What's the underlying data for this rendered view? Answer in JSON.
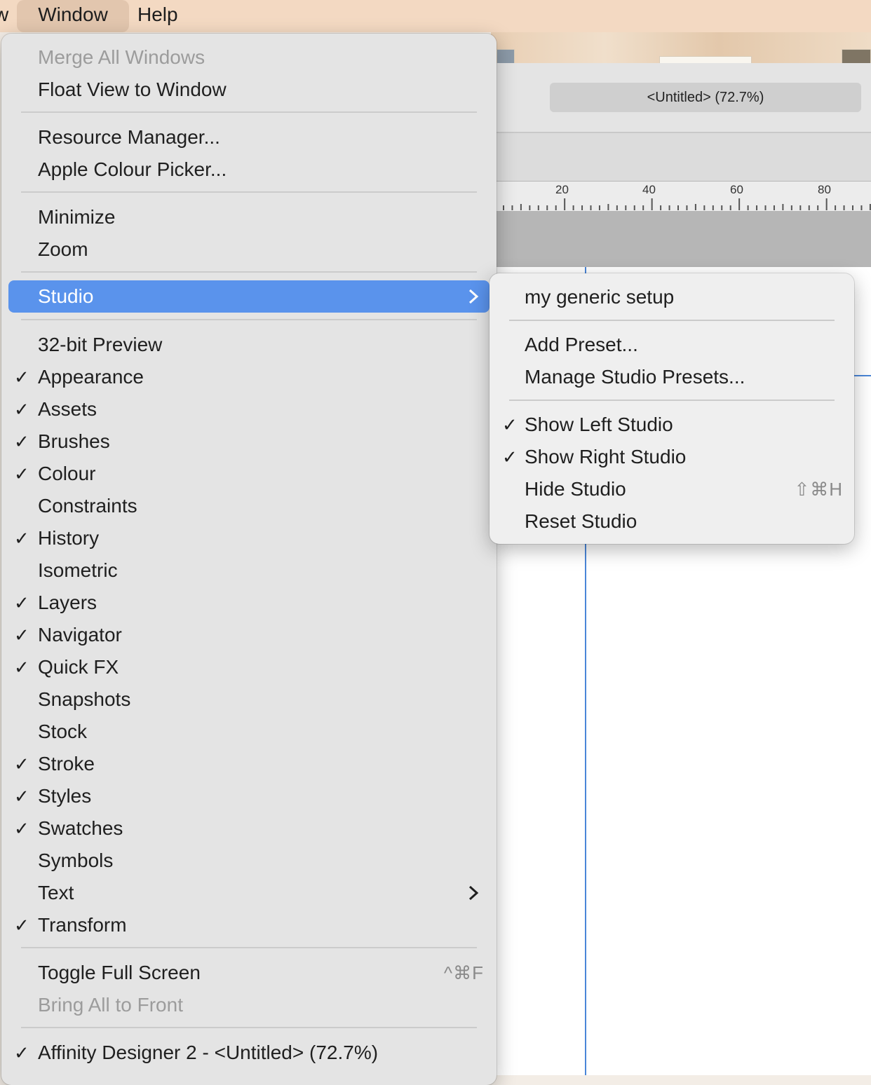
{
  "menubar": {
    "partial_item": "w",
    "window_label": "Window",
    "help_label": "Help"
  },
  "document": {
    "tab_title": "<Untitled> (72.7%)",
    "ruler_labels": [
      "20",
      "40",
      "60",
      "80"
    ]
  },
  "window_menu": {
    "merge_all_windows": "Merge All Windows",
    "float_view": "Float View to Window",
    "resource_manager": "Resource Manager...",
    "colour_picker": "Apple Colour Picker...",
    "minimize": "Minimize",
    "zoom": "Zoom",
    "studio": "Studio",
    "panels": [
      {
        "label": "32-bit Preview",
        "checked": false
      },
      {
        "label": "Appearance",
        "checked": true
      },
      {
        "label": "Assets",
        "checked": true
      },
      {
        "label": "Brushes",
        "checked": true
      },
      {
        "label": "Colour",
        "checked": true
      },
      {
        "label": "Constraints",
        "checked": false
      },
      {
        "label": "History",
        "checked": true
      },
      {
        "label": "Isometric",
        "checked": false
      },
      {
        "label": "Layers",
        "checked": true
      },
      {
        "label": "Navigator",
        "checked": true
      },
      {
        "label": "Quick FX",
        "checked": true
      },
      {
        "label": "Snapshots",
        "checked": false
      },
      {
        "label": "Stock",
        "checked": false
      },
      {
        "label": "Stroke",
        "checked": true
      },
      {
        "label": "Styles",
        "checked": true
      },
      {
        "label": "Swatches",
        "checked": true
      },
      {
        "label": "Symbols",
        "checked": false
      },
      {
        "label": "Text",
        "checked": false,
        "submenu": true
      },
      {
        "label": "Transform",
        "checked": true
      }
    ],
    "toggle_full_screen": "Toggle Full Screen",
    "toggle_full_screen_shortcut": "^⌘F",
    "bring_all_to_front": "Bring All to Front",
    "open_document": "Affinity Designer 2 - <Untitled> (72.7%)",
    "check_glyph": "✓"
  },
  "studio_menu": {
    "preset_1": "my generic setup",
    "add_preset": "Add Preset...",
    "manage_presets": "Manage Studio Presets...",
    "show_left": "Show Left Studio",
    "show_right": "Show Right Studio",
    "hide_studio": "Hide Studio",
    "hide_studio_shortcut": "⇧⌘H",
    "reset_studio": "Reset Studio"
  },
  "colors": {
    "highlight": "#5a93ec",
    "menubar": "#f3d9c2",
    "guide": "#4a86d8"
  }
}
